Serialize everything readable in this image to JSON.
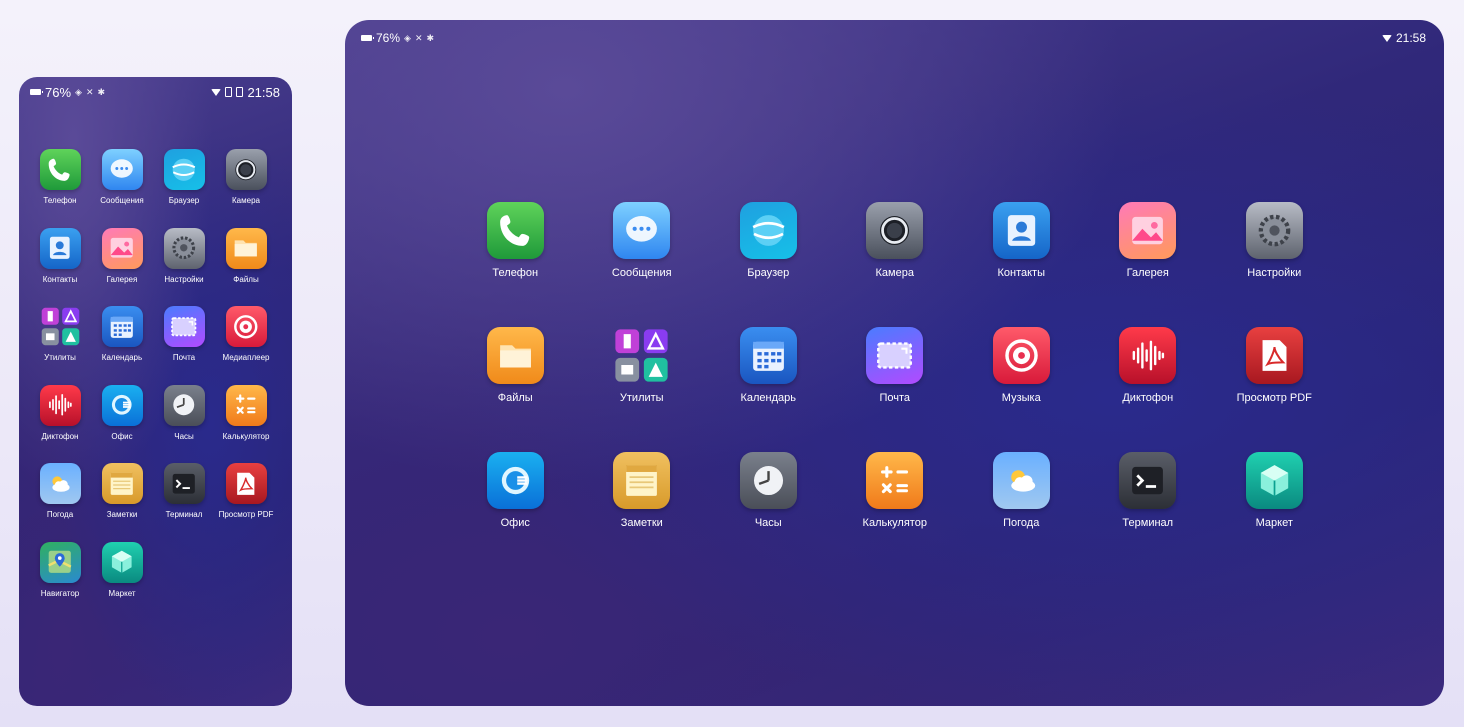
{
  "phone": {
    "status": {
      "battery": "76%",
      "time": "21:58"
    },
    "apps": [
      {
        "label": "Телефон",
        "icon": "phone-icon"
      },
      {
        "label": "Сообщения",
        "icon": "messages-icon"
      },
      {
        "label": "Браузер",
        "icon": "browser-icon"
      },
      {
        "label": "Камера",
        "icon": "camera-icon"
      },
      {
        "label": "Контакты",
        "icon": "contacts-icon"
      },
      {
        "label": "Галерея",
        "icon": "gallery-icon"
      },
      {
        "label": "Настройки",
        "icon": "settings-icon"
      },
      {
        "label": "Файлы",
        "icon": "files-icon"
      },
      {
        "label": "Утилиты",
        "icon": "utilities-icon"
      },
      {
        "label": "Календарь",
        "icon": "calendar-icon"
      },
      {
        "label": "Почта",
        "icon": "mail-icon"
      },
      {
        "label": "Медиаплеер",
        "icon": "mediaplayer-icon"
      },
      {
        "label": "Диктофон",
        "icon": "recorder-icon"
      },
      {
        "label": "Офис",
        "icon": "office-icon"
      },
      {
        "label": "Часы",
        "icon": "clock-icon"
      },
      {
        "label": "Калькулятор",
        "icon": "calculator-icon"
      },
      {
        "label": "Погода",
        "icon": "weather-icon"
      },
      {
        "label": "Заметки",
        "icon": "notes-icon"
      },
      {
        "label": "Терминал",
        "icon": "terminal-icon"
      },
      {
        "label": "Просмотр PDF",
        "icon": "pdf-icon"
      },
      {
        "label": "Навигатор",
        "icon": "navigator-icon"
      },
      {
        "label": "Маркет",
        "icon": "market-icon"
      }
    ]
  },
  "tablet": {
    "status": {
      "battery": "76%",
      "time": "21:58"
    },
    "apps": [
      {
        "label": "Телефон",
        "icon": "phone-icon"
      },
      {
        "label": "Сообщения",
        "icon": "messages-icon"
      },
      {
        "label": "Браузер",
        "icon": "browser-icon"
      },
      {
        "label": "Камера",
        "icon": "camera-icon"
      },
      {
        "label": "Контакты",
        "icon": "contacts-icon"
      },
      {
        "label": "Галерея",
        "icon": "gallery-icon"
      },
      {
        "label": "Настройки",
        "icon": "settings-icon"
      },
      {
        "label": "Файлы",
        "icon": "files-icon"
      },
      {
        "label": "Утилиты",
        "icon": "utilities-icon"
      },
      {
        "label": "Календарь",
        "icon": "calendar-icon"
      },
      {
        "label": "Почта",
        "icon": "mail-icon"
      },
      {
        "label": "Музыка",
        "icon": "music-icon"
      },
      {
        "label": "Диктофон",
        "icon": "recorder-icon"
      },
      {
        "label": "Просмотр PDF",
        "icon": "pdf-icon"
      },
      {
        "label": "Офис",
        "icon": "office-icon"
      },
      {
        "label": "Заметки",
        "icon": "notes-icon"
      },
      {
        "label": "Часы",
        "icon": "clock-icon"
      },
      {
        "label": "Калькулятор",
        "icon": "calculator-icon"
      },
      {
        "label": "Погода",
        "icon": "weather-icon"
      },
      {
        "label": "Терминал",
        "icon": "terminal-icon"
      },
      {
        "label": "Маркет",
        "icon": "market-icon"
      }
    ]
  }
}
